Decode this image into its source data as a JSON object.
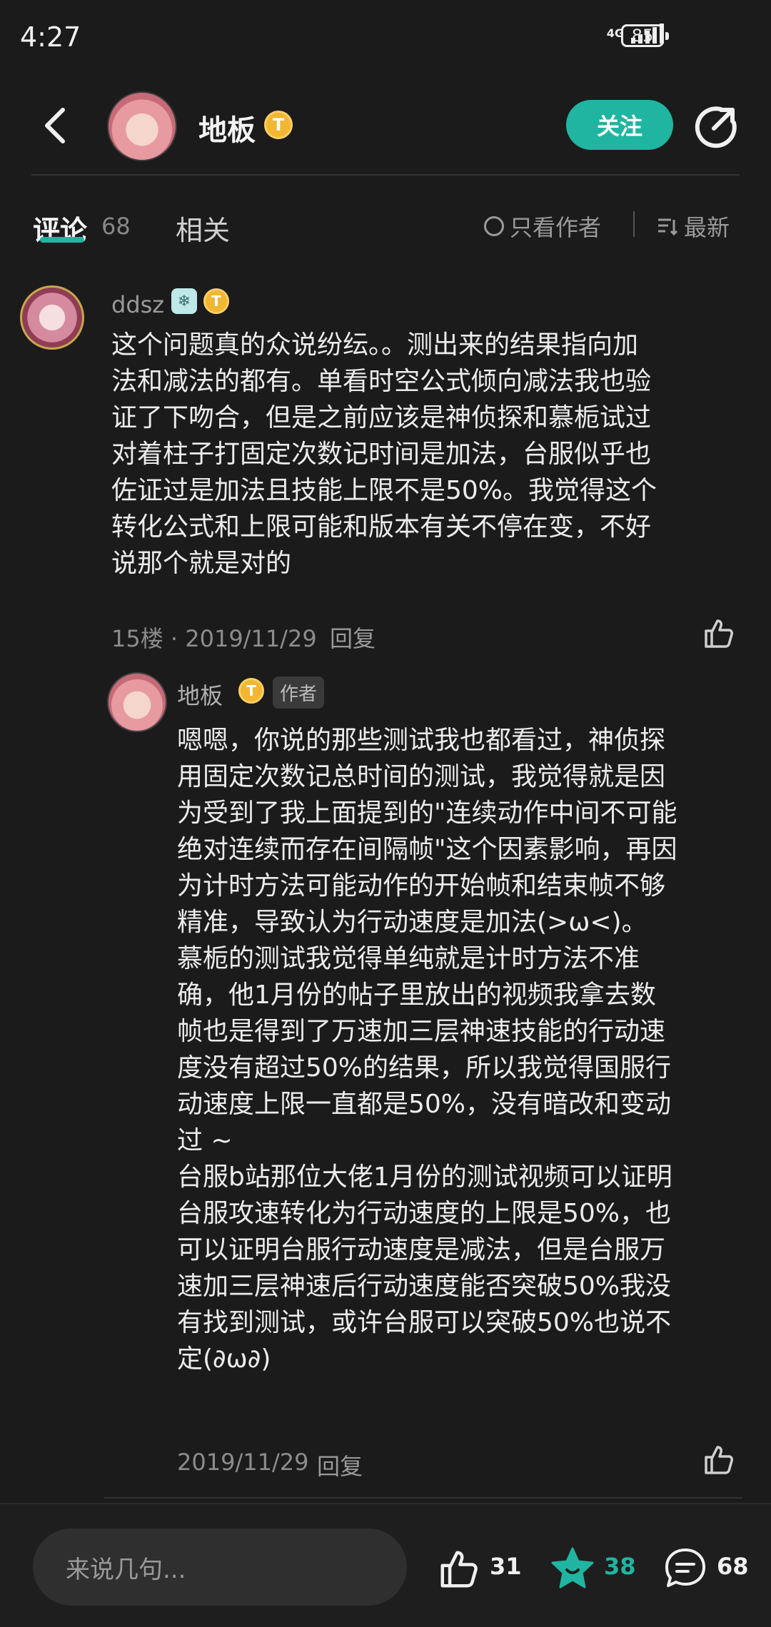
{
  "status_bar": {
    "time": "4:27",
    "network": "4G",
    "battery": "85"
  },
  "header": {
    "author_name": "地板",
    "author_badge": "T",
    "follow_label": "关注"
  },
  "tabs": {
    "comments_label": "评论",
    "comments_count": "68",
    "related_label": "相关",
    "author_only_label": "只看作者",
    "sort_label": "最新"
  },
  "comment": {
    "username": "ddsz",
    "level_badge": "❄",
    "badge": "T",
    "body": "这个问题真的众说纷纭。。测出来的结果指向加\n法和减法的都有。单看时空公式倾向减法我也验\n证了下吻合，但是之前应该是神侦探和慕栀试过\n对着柱子打固定次数记时间是加法，台服似乎也\n佐证过是加法且技能上限不是50%。我觉得这个\n转化公式和上限可能和版本有关不停在变，不好\n说那个就是对的",
    "meta": "15楼 · 2019/11/29",
    "reply_label": "回复"
  },
  "reply": {
    "username": "地板",
    "badge": "T",
    "author_tag": "作者",
    "body": "嗯嗯，你说的那些测试我也都看过，神侦探\n用固定次数记总时间的测试，我觉得就是因\n为受到了我上面提到的\"连续动作中间不可能\n绝对连续而存在间隔帧\"这个因素影响，再因\n为计时方法可能动作的开始帧和结束帧不够\n精准，导致认为行动速度是加法(>ω<)。\n慕栀的测试我觉得单纯就是计时方法不准\n确，他1月份的帖子里放出的视频我拿去数\n帧也是得到了万速加三层神速技能的行动速\n度没有超过50%的结果，所以我觉得国服行\n动速度上限一直都是50%，没有暗改和变动\n过 ~\n台服b站那位大佬1月份的测试视频可以证明\n台服攻速转化为行动速度的上限是50%，也\n可以证明台服行动速度是减法，但是台服万\n速加三层神速后行动速度能否突破50%我没\n有找到测试，或许台服可以突破50%也说不\n定(∂ω∂)",
    "meta": "2019/11/29",
    "reply_label": "回复"
  },
  "bottom_bar": {
    "input_placeholder": "来说几句...",
    "like_count": "31",
    "fav_count": "38",
    "comment_count": "68"
  },
  "colors": {
    "accent": "#1fb5a1",
    "background": "#1b1b1b",
    "badge_gold": "#f2b632"
  }
}
